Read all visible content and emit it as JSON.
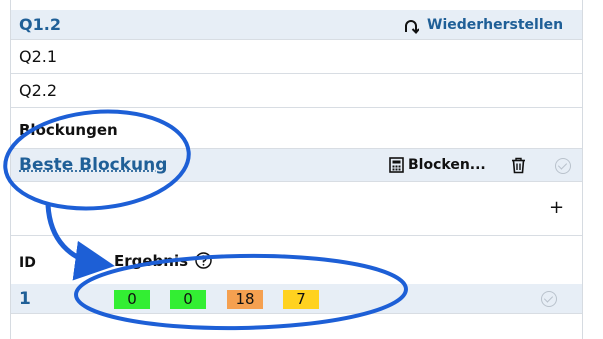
{
  "colors": {
    "header_bg": "#e7eef6",
    "link_blue": "#1f5f97",
    "annotation_blue": "#1d5fd6",
    "badge_green": "#33ee33",
    "badge_orange": "#f5a050",
    "badge_yellow": "#ffd21f"
  },
  "question_group": {
    "title": "Q1.2",
    "restore_label": "Wiederherstellen",
    "restore_icon": "undo-arrow-icon"
  },
  "questions": [
    "Q2.1",
    "Q2.2"
  ],
  "blockings": {
    "section_title": "Blockungen",
    "active_name": "Beste Blockung",
    "blocken_label": "Blocken...",
    "blocken_icon": "calculator-icon",
    "delete_icon": "trash-icon",
    "check_icon": "check-circle-icon",
    "add_label": "+"
  },
  "results_table": {
    "headers": {
      "id": "ID",
      "result": "Ergebnis"
    },
    "help_icon": "help-circle-icon",
    "rows": [
      {
        "id": "1",
        "badges": [
          "0",
          "0",
          "18",
          "7"
        ]
      }
    ]
  }
}
